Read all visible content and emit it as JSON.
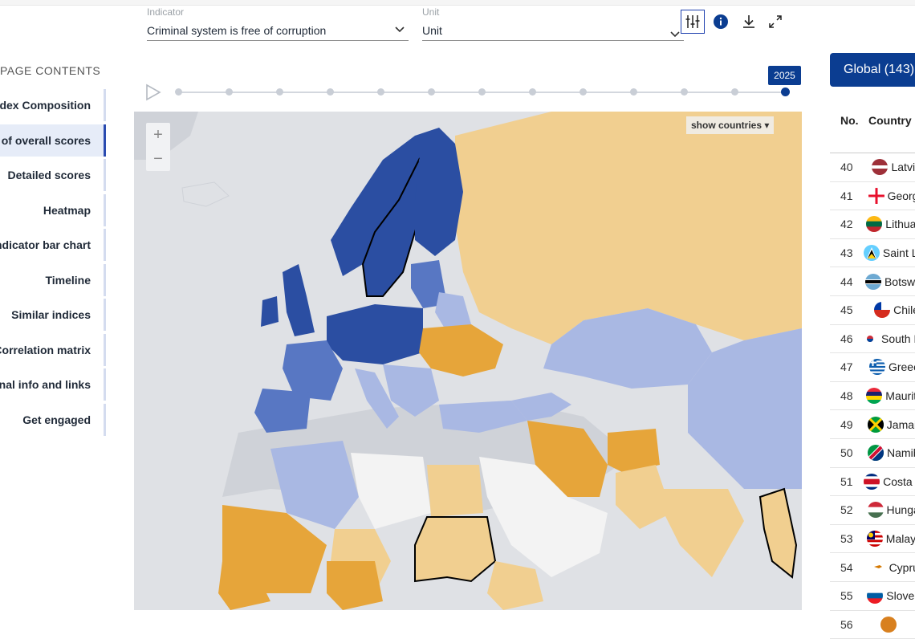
{
  "nav": {
    "title": "PAGE CONTENTS",
    "items": [
      {
        "label": "Index Composition",
        "active": false
      },
      {
        "label": "Map of overall scores",
        "active": true
      },
      {
        "label": "Detailed scores",
        "active": false
      },
      {
        "label": "Heatmap",
        "active": false
      },
      {
        "label": "Indicator bar chart",
        "active": false
      },
      {
        "label": "Timeline",
        "active": false
      },
      {
        "label": "Similar indices",
        "active": false
      },
      {
        "label": "Correlation matrix",
        "active": false
      },
      {
        "label": "Additional info and links",
        "active": false
      },
      {
        "label": "Get engaged",
        "active": false
      }
    ]
  },
  "controls": {
    "indicator": {
      "label": "Indicator",
      "value": "Criminal system is free of corruption"
    },
    "unit": {
      "label": "Unit",
      "value": "Unit"
    },
    "icons": [
      "settings-sliders-icon",
      "info-icon",
      "download-icon",
      "expand-icon"
    ]
  },
  "timeline": {
    "current_year": "2025",
    "tick_count": 13
  },
  "map": {
    "show_countries_label": "show countries",
    "zoom_in": "+",
    "zoom_out": "−",
    "colors": {
      "dark_blue": "#2b4ea2",
      "mid_blue": "#5877c3",
      "light_blue": "#a9b8e3",
      "orange": "#e6a53a",
      "light_orange": "#f1cf90",
      "gray": "#cfd2d8",
      "white": "#f3f3f3",
      "sea": "#dfe1e5"
    }
  },
  "table": {
    "tab_label": "Global (143)",
    "col_no": "No.",
    "col_country": "Country",
    "rows": [
      {
        "no": "40",
        "name": "Latvia",
        "flag": "latvia"
      },
      {
        "no": "41",
        "name": "Georgia",
        "flag": "georgia"
      },
      {
        "no": "42",
        "name": "Lithuania",
        "flag": "lithuania"
      },
      {
        "no": "43",
        "name": "Saint Lucia",
        "flag": "saint-lucia"
      },
      {
        "no": "44",
        "name": "Botswana",
        "flag": "botswana"
      },
      {
        "no": "45",
        "name": "Chile",
        "flag": "chile"
      },
      {
        "no": "46",
        "name": "South Korea",
        "flag": "south-korea"
      },
      {
        "no": "47",
        "name": "Greece",
        "flag": "greece"
      },
      {
        "no": "48",
        "name": "Mauritius",
        "flag": "mauritius"
      },
      {
        "no": "49",
        "name": "Jamaica",
        "flag": "jamaica"
      },
      {
        "no": "50",
        "name": "Namibia",
        "flag": "namibia"
      },
      {
        "no": "51",
        "name": "Costa Rica",
        "flag": "costa-rica"
      },
      {
        "no": "52",
        "name": "Hungary",
        "flag": "hungary"
      },
      {
        "no": "53",
        "name": "Malaysia",
        "flag": "malaysia"
      },
      {
        "no": "54",
        "name": "Cyprus",
        "flag": "cyprus"
      },
      {
        "no": "55",
        "name": "Slovenia",
        "flag": "slovenia"
      },
      {
        "no": "56",
        "name": "",
        "flag": "unknown"
      }
    ]
  }
}
